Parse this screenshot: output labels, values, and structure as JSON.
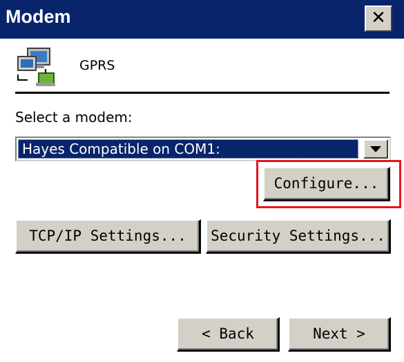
{
  "window": {
    "title": "Modem",
    "close_glyph": "✕"
  },
  "connection": {
    "icon": "network-computer-icon",
    "name": "GPRS"
  },
  "modem_select": {
    "label": "Select a modem:",
    "value": "Hayes Compatible on COM1:"
  },
  "buttons": {
    "configure": "Configure...",
    "tcpip": "TCP/IP Settings...",
    "security": "Security Settings...",
    "back": "< Back",
    "next": "Next >"
  },
  "colors": {
    "titlebar": "#08246b",
    "selection": "#08246b",
    "button_face": "#d4d0c8",
    "highlight_box": "#e8141e"
  }
}
